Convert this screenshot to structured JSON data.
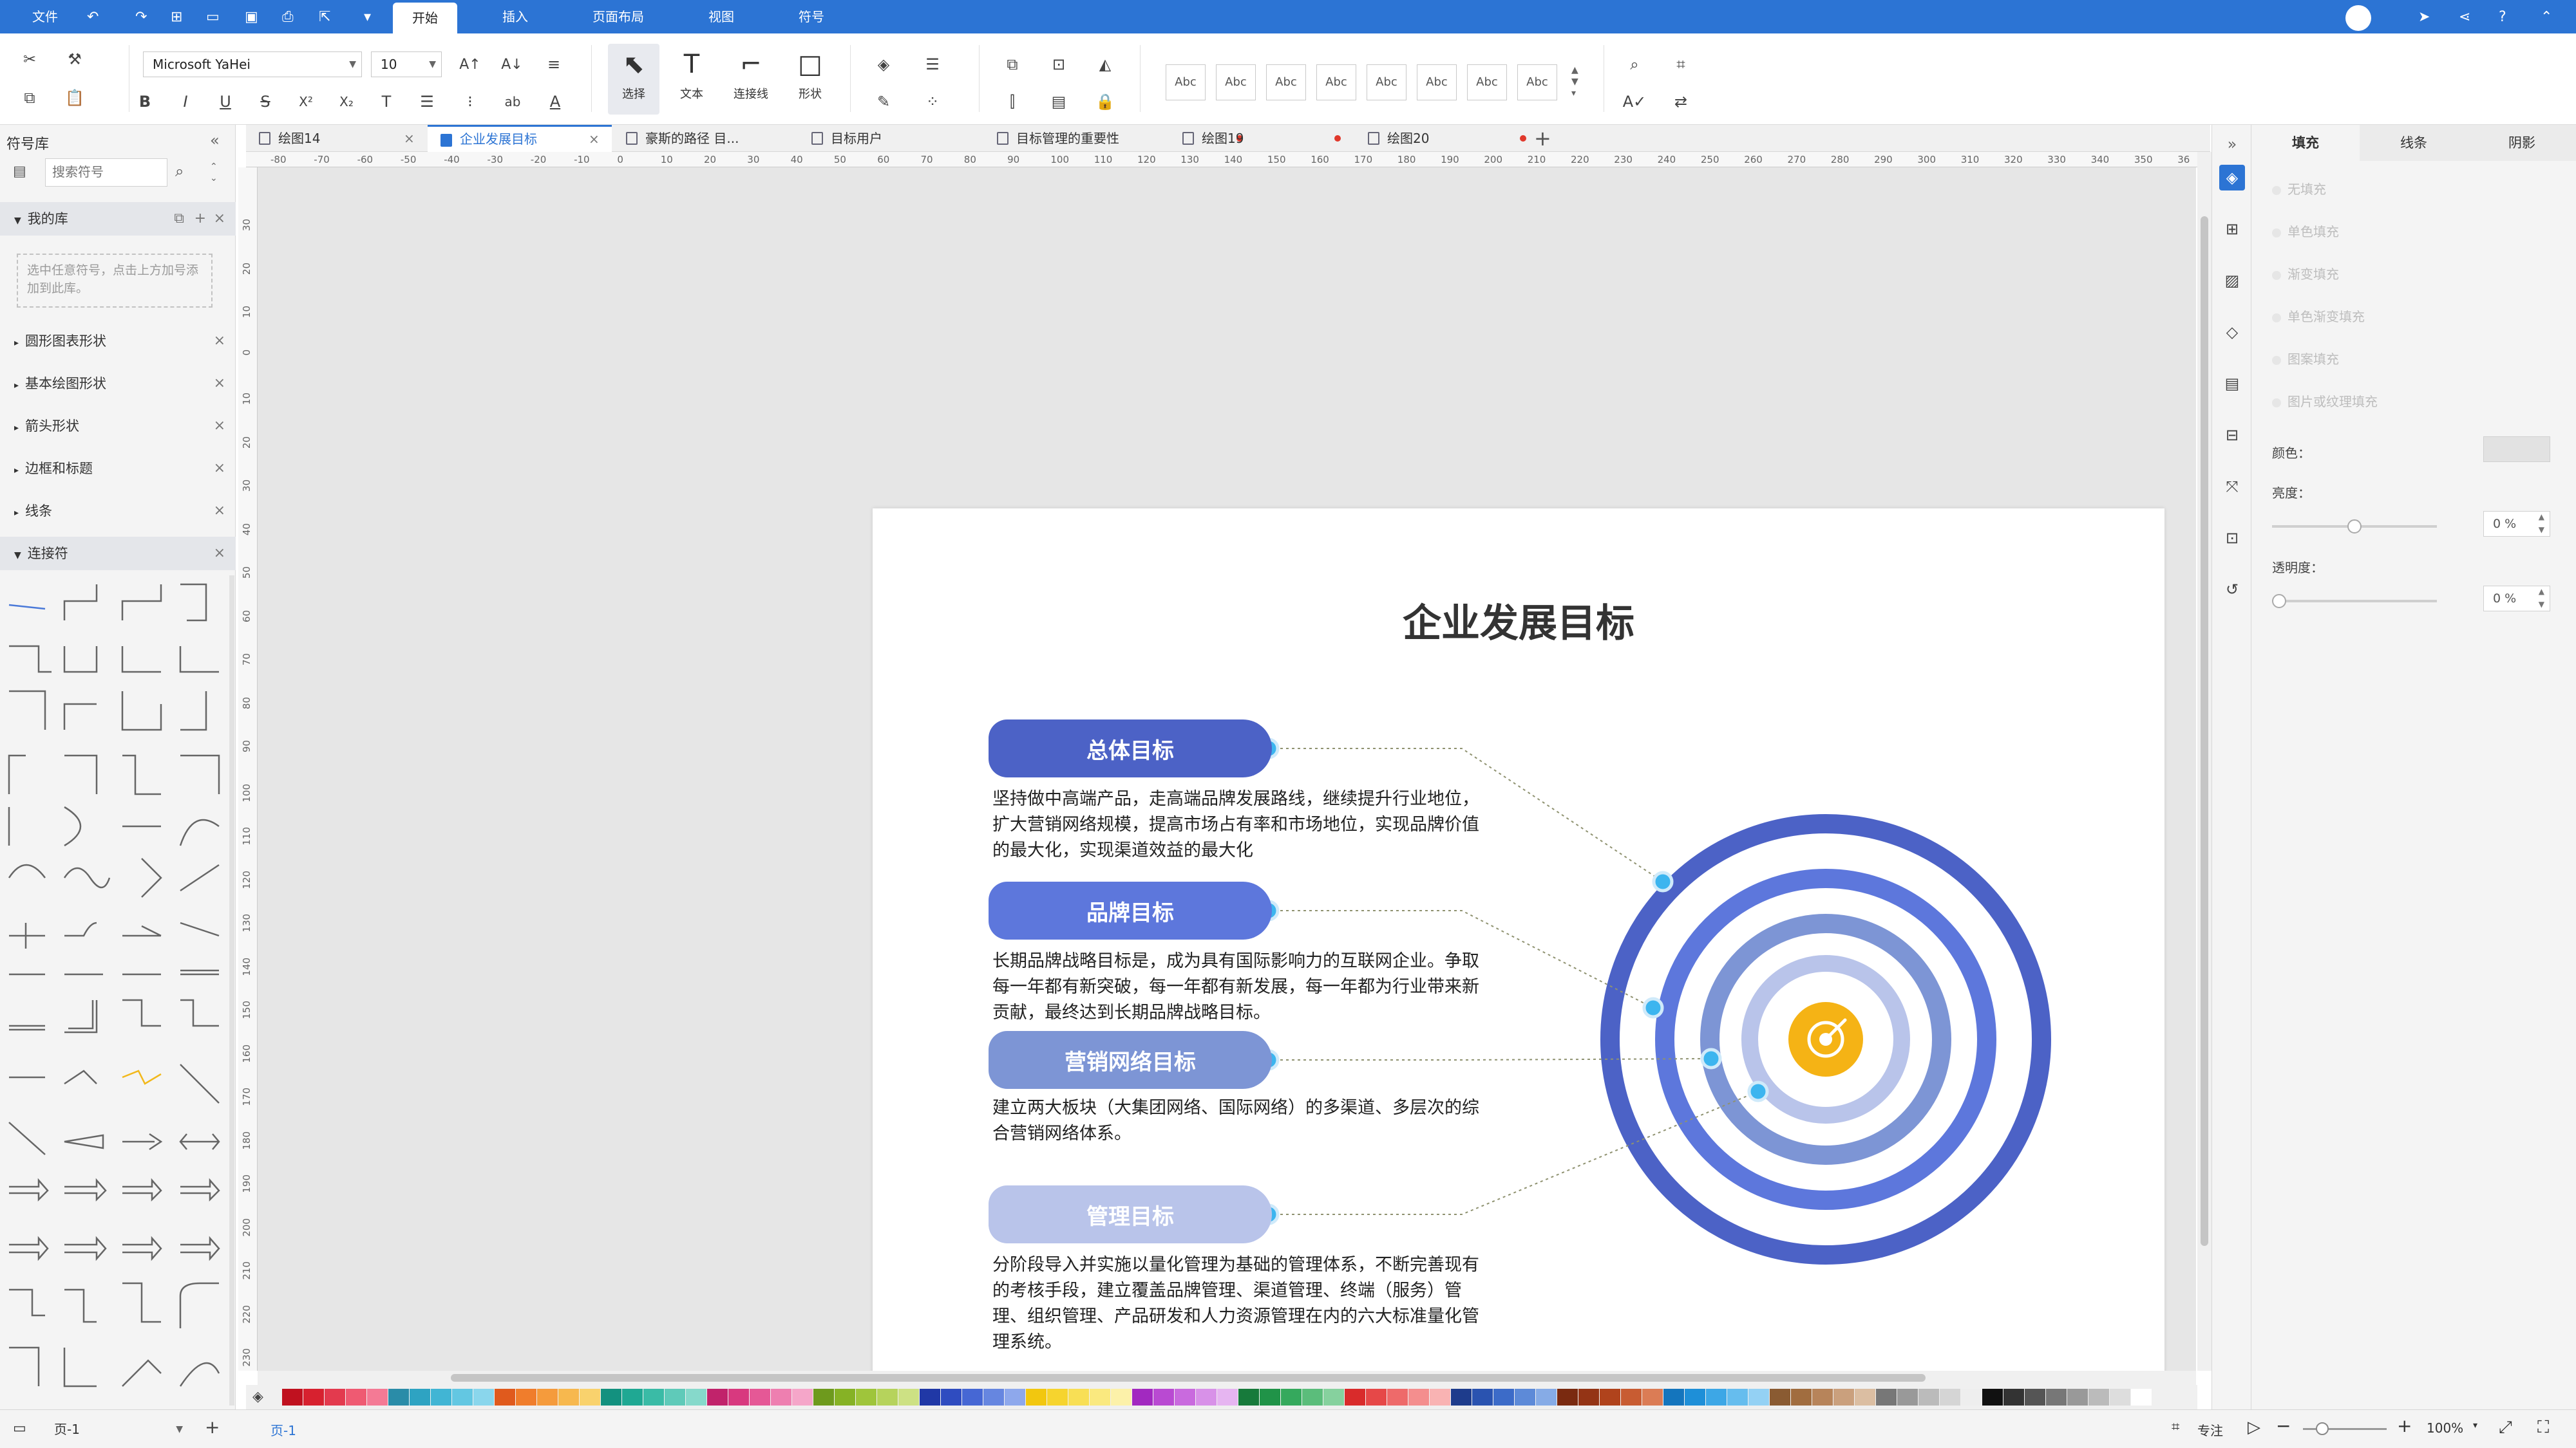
{
  "menubar": {
    "file": "文件",
    "tabs": [
      "开始",
      "插入",
      "页面布局",
      "视图",
      "符号"
    ],
    "active_tab": "开始"
  },
  "toolbar": {
    "font_name": "Microsoft YaHei",
    "font_size": "10",
    "select_label": "选择",
    "text_label": "文本",
    "connector_label": "连接线",
    "shape_label": "形状",
    "style_sample": "Abc"
  },
  "left_panel": {
    "title": "符号库",
    "search_placeholder": "搜索符号",
    "my_library": "我的库",
    "my_library_hint": "选中任意符号，点击上方加号添加到此库。",
    "sections": [
      "圆形图表形状",
      "基本绘图形状",
      "箭头形状",
      "边框和标题",
      "线条",
      "连接符"
    ]
  },
  "doc_tabs": [
    {
      "label": "绘图14",
      "modified": false
    },
    {
      "label": "企业发展目标",
      "modified": false,
      "active": true
    },
    {
      "label": "豪斯的路径 目...",
      "modified": false
    },
    {
      "label": "目标用户",
      "modified": false
    },
    {
      "label": "目标管理的重要性",
      "modified": true
    },
    {
      "label": "绘图19",
      "modified": true
    },
    {
      "label": "绘图20",
      "modified": true
    }
  ],
  "rulers": {
    "h_ticks": [
      "-80",
      "-70",
      "-60",
      "-50",
      "-40",
      "-30",
      "-20",
      "-10",
      "0",
      "10",
      "20",
      "30",
      "40",
      "50",
      "60",
      "70",
      "80",
      "90",
      "100",
      "110",
      "120",
      "130",
      "140",
      "150",
      "160",
      "170",
      "180",
      "190",
      "200",
      "210",
      "220",
      "230",
      "240",
      "250",
      "260",
      "270",
      "280",
      "290",
      "300",
      "310",
      "320",
      "330",
      "340",
      "350",
      "36"
    ],
    "v_ticks": [
      "30",
      "20",
      "10",
      "0",
      "10",
      "20",
      "30",
      "40",
      "50",
      "60",
      "70",
      "80",
      "90",
      "100",
      "110",
      "120",
      "130",
      "140",
      "150",
      "160",
      "170",
      "180",
      "190",
      "200",
      "210",
      "220",
      "230"
    ]
  },
  "diagram": {
    "title": "企业发展目标",
    "goals": [
      {
        "label": "总体目标",
        "text": "坚持做中高端产品，走高端品牌发展路线，继续提升行业地位，扩大营销网络规模，提高市场占有率和市场地位，实现品牌价值的最大化，实现渠道效益的最大化",
        "color": "#4c62c6"
      },
      {
        "label": "品牌目标",
        "text": "长期品牌战略目标是，成为具有国际影响力的互联网企业。争取每一年都有新突破，每一年都有新发展，每一年都为行业带来新贡献，最终达到长期品牌战略目标。",
        "color": "#5d77dc"
      },
      {
        "label": "营销网络目标",
        "text": "建立两大板块（大集团网络、国际网络）的多渠道、多层次的综合营销网络体系。",
        "color": "#7d95d5"
      },
      {
        "label": "管理目标",
        "text": "分阶段导入并实施以量化管理为基础的管理体系，不断完善现有的考核手段，建立覆盖品牌管理、渠道管理、终端（服务）管理、组织管理、产品研发和人力资源管理在内的六大标准量化管理系统。",
        "color": "#b9c4ea"
      }
    ],
    "target_center_color": "#f5b315",
    "ring_colors": [
      "#4c62c6",
      "#5d77dc",
      "#7d95d5",
      "#b9c4ea"
    ],
    "connector_dot_color": "#3cb5ef"
  },
  "right_panel": {
    "tabs": [
      "填充",
      "线条",
      "阴影"
    ],
    "active_tab": "填充",
    "fill_options": [
      "无填充",
      "单色填充",
      "渐变填充",
      "单色渐变填充",
      "图案填充",
      "图片或纹理填充"
    ],
    "color_label": "颜色：",
    "brightness_label": "亮度：",
    "brightness_value": "0 %",
    "brightness_level": 0.5,
    "transparency_label": "透明度：",
    "transparency_value": "0 %",
    "transparency_level": 0
  },
  "statusbar": {
    "page_select": "页-1",
    "page_tab": "页-1",
    "focus_label": "专注",
    "zoom": "100%"
  },
  "palette_colors": [
    "#c0111f",
    "#d7212f",
    "#e33a4e",
    "#ef5a72",
    "#f47a95",
    "#2a8ca8",
    "#2ea3c2",
    "#41b5d4",
    "#63c7e2",
    "#8ad6ec",
    "#e05a1d",
    "#f07d2c",
    "#f59b3c",
    "#f7b84e",
    "#f9d26d",
    "#13917f",
    "#1fa893",
    "#3abba6",
    "#5fcab9",
    "#86d9cb",
    "#c1236b",
    "#d8397f",
    "#e55896",
    "#ee7fb0",
    "#f5a6c9",
    "#6e9a1d",
    "#86b225",
    "#9fc53b",
    "#b6d35c",
    "#cde184",
    "#2038a6",
    "#2f4cc0",
    "#4667d4",
    "#6686e0",
    "#8ea8ec",
    "#f2c70f",
    "#f6d42e",
    "#f8df55",
    "#fae97f",
    "#fcf1a9",
    "#a229c0",
    "#b94ad2",
    "#c96ade",
    "#d891e8",
    "#e6b5f1",
    "#177a3b",
    "#209348",
    "#35a95d",
    "#5bbd7b",
    "#86d19e",
    "#d92b2b",
    "#e64848",
    "#ee6a6a",
    "#f48e8e",
    "#f9b3b3",
    "#1e3c8c",
    "#2a53b0",
    "#3c6bc8",
    "#5d8ad8",
    "#86abe6",
    "#7a2a10",
    "#943415",
    "#b0431c",
    "#c85c32",
    "#db7c55",
    "#1475bd",
    "#1e8fd8",
    "#3da7e6",
    "#66bdee",
    "#94d1f4",
    "#8a5b32",
    "#a16d3f",
    "#b7845a",
    "#caa07d",
    "#dbbea2",
    "#777777",
    "#999999",
    "#bbbbbb",
    "#d5d5d5",
    "#eeeeee",
    "#111111",
    "#333333",
    "#555555",
    "#777777",
    "#999999",
    "#bbbbbb",
    "#dddddd",
    "#ffffff"
  ]
}
